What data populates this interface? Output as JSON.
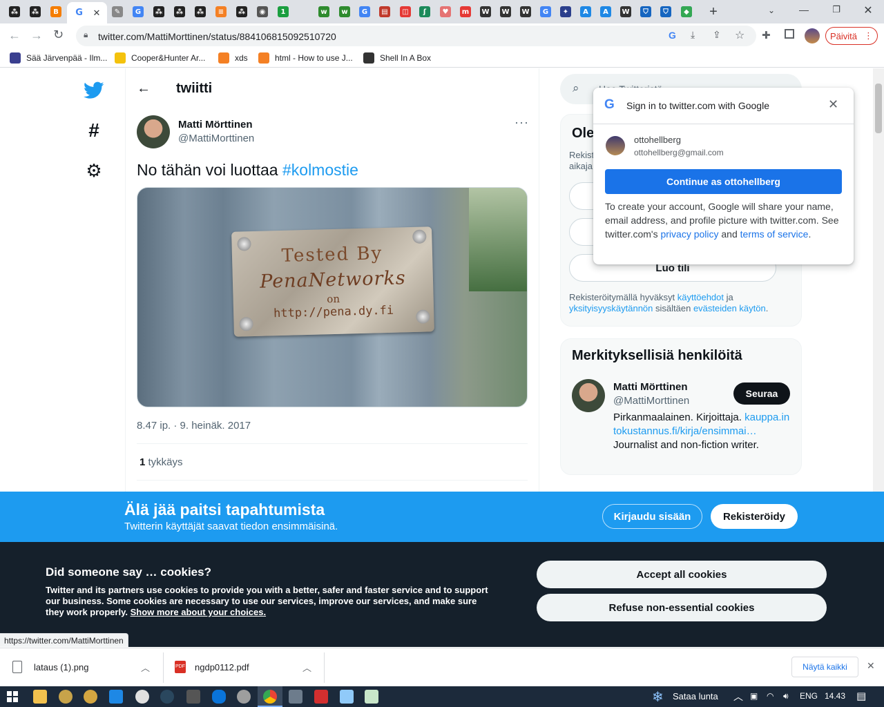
{
  "browser": {
    "url": "twitter.com/MattiMorttinen/status/884106815092510720",
    "update_button": "Päivitä",
    "tabs": [
      {
        "icon": "qr-icon",
        "color": "#222222",
        "glyph": "⁂"
      },
      {
        "icon": "qr-icon",
        "color": "#222222",
        "glyph": "⁂"
      },
      {
        "icon": "blogger-icon",
        "color": "#f57d00",
        "glyph": "B"
      },
      {
        "icon": "google-icon",
        "color": "#4285f4",
        "glyph": "G"
      },
      {
        "icon": "feather-icon",
        "color": "#888888",
        "glyph": "✎"
      },
      {
        "icon": "google-icon",
        "color": "#4285f4",
        "glyph": "G"
      },
      {
        "icon": "qr-icon",
        "color": "#222222",
        "glyph": "⁂"
      },
      {
        "icon": "qr-icon",
        "color": "#222222",
        "glyph": "⁂"
      },
      {
        "icon": "qr-icon",
        "color": "#222222",
        "glyph": "⁂"
      },
      {
        "icon": "stack-icon",
        "color": "#f48024",
        "glyph": "≡"
      },
      {
        "icon": "qr-icon",
        "color": "#222222",
        "glyph": "⁂"
      },
      {
        "icon": "globe-icon",
        "color": "#555555",
        "glyph": "◉"
      },
      {
        "icon": "one-icon",
        "color": "#1a9e3f",
        "glyph": "1"
      },
      {
        "icon": "w-green-icon",
        "color": "#2e8b2e",
        "glyph": "w"
      },
      {
        "icon": "w-green-icon",
        "color": "#2e8b2e",
        "glyph": "w"
      },
      {
        "icon": "google-icon",
        "color": "#4285f4",
        "glyph": "G"
      },
      {
        "icon": "chart-icon",
        "color": "#c0392b",
        "glyph": "▤"
      },
      {
        "icon": "squares-icon",
        "color": "#e53935",
        "glyph": "◫"
      },
      {
        "icon": "leaf-icon",
        "color": "#1b8a5a",
        "glyph": "ʃ"
      },
      {
        "icon": "heart-icon",
        "color": "#e57373",
        "glyph": "♥"
      },
      {
        "icon": "mtv-icon",
        "color": "#e53935",
        "glyph": "m"
      },
      {
        "icon": "wikipedia-icon",
        "color": "#333333",
        "glyph": "W"
      },
      {
        "icon": "wikipedia-icon",
        "color": "#333333",
        "glyph": "W"
      },
      {
        "icon": "wikipedia-icon",
        "color": "#333333",
        "glyph": "W"
      },
      {
        "icon": "google-icon",
        "color": "#4285f4",
        "glyph": "G"
      },
      {
        "icon": "seal-icon",
        "color": "#2b3f8c",
        "glyph": "✦"
      },
      {
        "icon": "a-icon",
        "color": "#1e88e5",
        "glyph": "A"
      },
      {
        "icon": "a-icon",
        "color": "#1e88e5",
        "glyph": "A"
      },
      {
        "icon": "wikipedia-icon",
        "color": "#333333",
        "glyph": "W"
      },
      {
        "icon": "shield-icon",
        "color": "#1565c0",
        "glyph": "⛉"
      },
      {
        "icon": "shield-icon",
        "color": "#1565c0",
        "glyph": "⛉"
      },
      {
        "icon": "shield-icon",
        "color": "#1565c0",
        "glyph": "⛉"
      },
      {
        "icon": "maps-icon",
        "color": "#34a853",
        "glyph": "◆"
      }
    ],
    "bookmarks": [
      {
        "label": "Sää Järvenpää - Ilm...",
        "color": "#3a3f8f"
      },
      {
        "label": "Cooper&Hunter Ar...",
        "color": "#f4c20d"
      },
      {
        "label": "xds",
        "color": "#f48024"
      },
      {
        "label": "html - How to use J...",
        "color": "#f48024"
      },
      {
        "label": "Shell In A Box",
        "color": "#333333"
      }
    ]
  },
  "tweet": {
    "header_title": "twiitti",
    "author_name": "Matti Mörttinen",
    "author_handle": "@MattiMorttinen",
    "text": "No tähän voi luottaa ",
    "hashtag": "#kolmostie",
    "image": {
      "line1": "Tested By",
      "line2": "PenaNetworks",
      "line3": "on",
      "line4": "http://pena.dy.fi"
    },
    "timestamp": "8.47 ip. · 9. heinäk. 2017",
    "likes_count": "1",
    "likes_label": "tykkäys"
  },
  "sidebar": {
    "search_placeholder": "Hae Twitteristä",
    "signup_title": "Ole",
    "signup_desc_1": "Rekist",
    "signup_desc_2": "aikaja",
    "create_account": "Luo tili",
    "terms_pre": "Rekisteröitymällä hyväksyt ",
    "terms_link": "käyttöehdot",
    "terms_mid": " ja",
    "privacy_link": "yksityisyyskäytännön",
    "terms_mid2": " sisältäen ",
    "cookie_link": "evästeiden käytön",
    "terms_end": ".",
    "relevant_title": "Merkityksellisiä henkilöitä",
    "person_name": "Matti Mörttinen",
    "person_handle": "@MattiMorttinen",
    "follow_button": "Seuraa",
    "bio_1": "Pirkanmaalainen. Kirjoittaja.",
    "bio_link": "kauppa.intokustannus.fi/kirja/ensimmai…",
    "bio_2": " Journalist and non-fiction writer."
  },
  "google_popup": {
    "title": "Sign in to twitter.com with Google",
    "account_name": "ottohellberg",
    "account_email": "ottohellberg@gmail.com",
    "continue_button": "Continue as ottohellberg",
    "body_pre": "To create your account, Google will share your name, email address, and profile picture with twitter.com. See twitter.com's ",
    "privacy_link": "privacy policy",
    "body_mid": " and ",
    "terms_link": "terms of service",
    "body_end": "."
  },
  "blue_banner": {
    "title": "Älä jää paitsi tapahtumista",
    "subtitle": "Twitterin käyttäjät saavat tiedon ensimmäisinä.",
    "login_button": "Kirjaudu sisään",
    "signup_button": "Rekisteröidy"
  },
  "cookie_banner": {
    "title": "Did someone say … cookies?",
    "body": "Twitter and its partners use cookies to provide you with a better, safer and faster service and to support our business. Some cookies are necessary to use our services, improve our services, and make sure they work properly. ",
    "link": "Show more about your choices.",
    "accept_button": "Accept all cookies",
    "refuse_button": "Refuse non-essential cookies"
  },
  "status_url": "https://twitter.com/MattiMorttinen",
  "downloads": {
    "items": [
      {
        "name": "lataus (1).png"
      },
      {
        "name": "ngdp0112.pdf"
      }
    ],
    "show_all": "Näytä kaikki"
  },
  "taskbar": {
    "weather": "Sataa lunta",
    "lang": "ENG",
    "time": "14.43"
  },
  "colors": {
    "twitter_blue": "#1d9bf0",
    "google_blue": "#1a73e8",
    "cookie_bg": "#15202b"
  }
}
